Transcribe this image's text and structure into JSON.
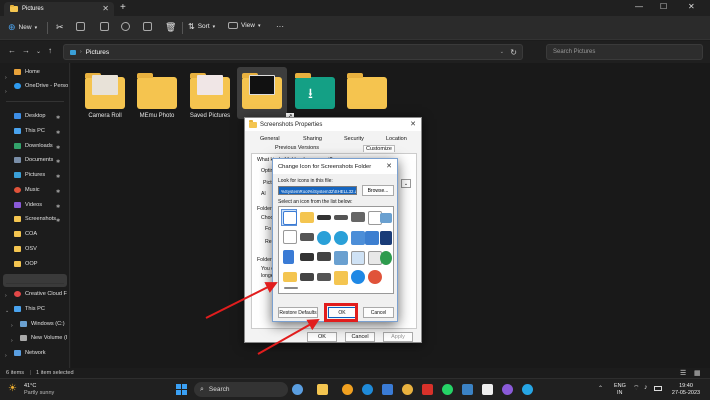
{
  "window": {
    "tab_title": "Pictures",
    "tab_close": "✕",
    "new_tab": "+",
    "minimize": "—",
    "maximize": "☐",
    "close": "✕"
  },
  "command_bar": {
    "new_label": "New",
    "sort_label": "Sort",
    "view_label": "View",
    "more": "···"
  },
  "address_bar": {
    "path_item": "Pictures",
    "search_placeholder": "Search Pictures"
  },
  "sidebar": {
    "items": [
      {
        "label": "Home",
        "icon": "home-icon",
        "color": "#e8a23a"
      },
      {
        "label": "OneDrive - Perso",
        "icon": "cloud-icon",
        "color": "#2e9bf0"
      },
      {
        "label": "Desktop",
        "icon": "desktop-icon",
        "color": "#3d8ee6"
      },
      {
        "label": "This PC",
        "icon": "pc-icon",
        "color": "#4aa3ee"
      },
      {
        "label": "Downloads",
        "icon": "download-icon",
        "color": "#33a36b"
      },
      {
        "label": "Documents",
        "icon": "document-icon",
        "color": "#7a8ea8"
      },
      {
        "label": "Pictures",
        "icon": "pictures-icon",
        "color": "#3aa0d8"
      },
      {
        "label": "Music",
        "icon": "music-icon",
        "color": "#e0533a"
      },
      {
        "label": "Videos",
        "icon": "video-icon",
        "color": "#8a5ad8"
      },
      {
        "label": "Screenshots",
        "icon": "folder-icon",
        "color": "#f4c550"
      },
      {
        "label": "COA",
        "icon": "folder-icon",
        "color": "#f4c550"
      },
      {
        "label": "OSV",
        "icon": "folder-icon",
        "color": "#f4c550"
      },
      {
        "label": "OOP",
        "icon": "folder-icon",
        "color": "#f4c550"
      },
      {
        "label": "Creative Cloud F",
        "icon": "creative-cloud-icon",
        "color": "#e34848"
      },
      {
        "label": "This PC",
        "icon": "pc-icon",
        "color": "#4aa3ee"
      },
      {
        "label": "Windows (C:)",
        "icon": "drive-icon",
        "color": "#6aa0d0"
      },
      {
        "label": "New Volume (I",
        "icon": "drive-icon",
        "color": "#aaaaaa"
      },
      {
        "label": "Network",
        "icon": "network-icon",
        "color": "#5a9ee0"
      }
    ]
  },
  "folders": [
    {
      "label": "Camera Roll",
      "icon": "folder-photo-icon"
    },
    {
      "label": "MEmu Photo",
      "icon": "folder-icon"
    },
    {
      "label": "Saved Pictures",
      "icon": "folder-photo-icon"
    },
    {
      "label": "",
      "icon": "folder-photo-icon"
    },
    {
      "label": "",
      "icon": "download-folder-icon"
    },
    {
      "label": "",
      "icon": "folder-icon"
    }
  ],
  "status": {
    "items": "6 items",
    "selected": "1 item selected"
  },
  "properties_dialog": {
    "title": "Screenshots Properties",
    "tabs": [
      "General",
      "Sharing",
      "Security",
      "Location",
      "Previous Versions",
      "Customize"
    ],
    "fragments": [
      "What kind of folder do you want?",
      "Optim",
      "Pictu",
      "Al",
      "Folder",
      "Choos",
      "Fo",
      "Re",
      "Folder",
      "You ca",
      "longer"
    ],
    "ok": "OK",
    "cancel": "Cancel",
    "apply": "Apply"
  },
  "change_icon_dialog": {
    "title": "Change Icon for Screenshots Folder",
    "look_label": "Look for icons in this file:",
    "path_value": "%SystemRoot%\\System32\\SHELL32.dll",
    "browse_label": "Browse...",
    "select_label": "Select an icon from the list below:",
    "restore_label": "Restore Defaults",
    "ok_label": "OK",
    "cancel_label": "Cancel"
  },
  "taskbar": {
    "weather_temp": "41°C",
    "weather_desc": "Partly sunny",
    "search_label": "Search",
    "lang_top": "ENG",
    "lang_bottom": "IN",
    "time": "19:40",
    "date": "27-05-2023"
  },
  "colors": {
    "highlight_red": "#e11d1d",
    "selection_blue": "#1565c0"
  }
}
